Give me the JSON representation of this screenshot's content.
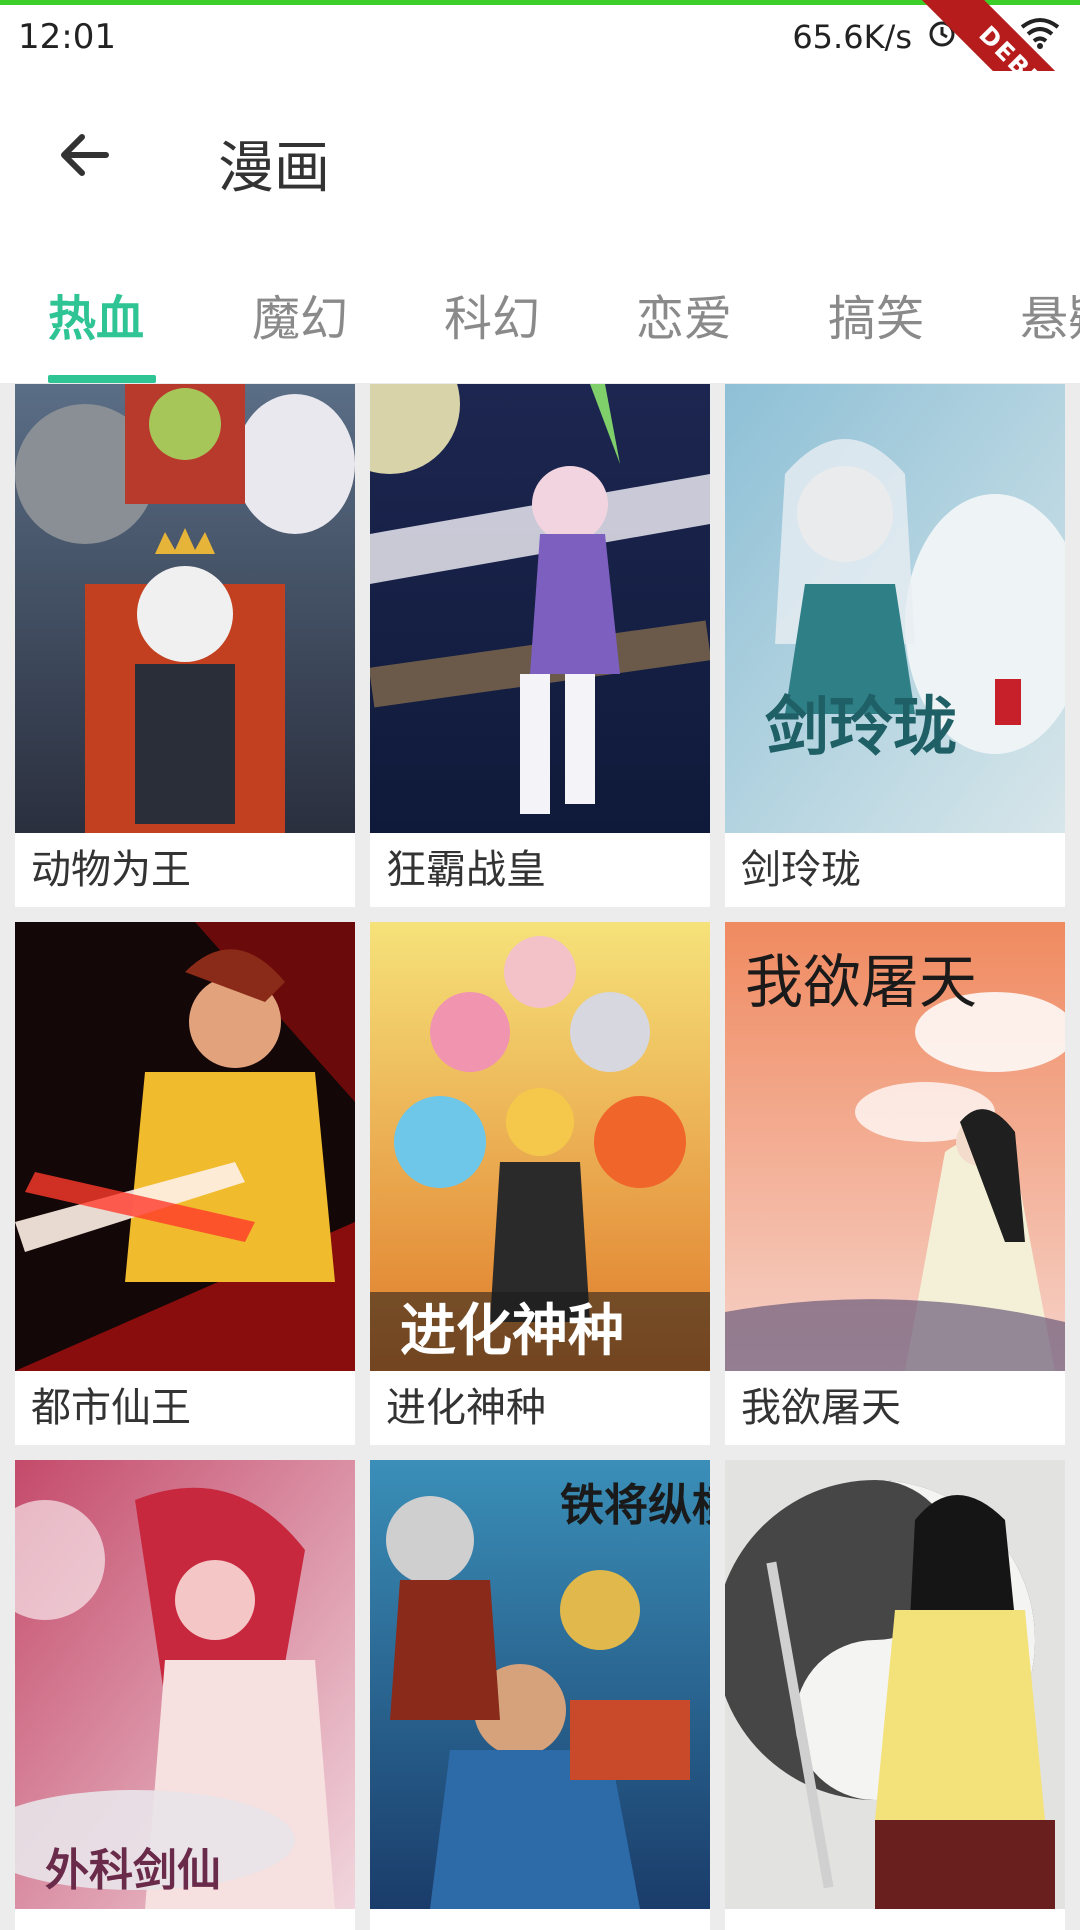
{
  "status": {
    "time": "12:01",
    "speed": "65.6K/s",
    "debug": "DEBUG"
  },
  "appbar": {
    "title": "漫画"
  },
  "tabs": [
    {
      "label": "热血",
      "active": true
    },
    {
      "label": "魔幻",
      "active": false
    },
    {
      "label": "科幻",
      "active": false
    },
    {
      "label": "恋爱",
      "active": false
    },
    {
      "label": "搞笑",
      "active": false
    },
    {
      "label": "悬疑",
      "active": false
    }
  ],
  "comics": [
    {
      "title": "动物为王",
      "cover_text": ""
    },
    {
      "title": "狂霸战皇",
      "cover_text": ""
    },
    {
      "title": "剑玲珑",
      "cover_text": "剑玲珑"
    },
    {
      "title": "都市仙王",
      "cover_text": ""
    },
    {
      "title": "进化神种",
      "cover_text": "进化神种"
    },
    {
      "title": "我欲屠天",
      "cover_text": "我欲屠天"
    },
    {
      "title": "",
      "cover_text": "外科剑仙"
    },
    {
      "title": "",
      "cover_text": "铁将纵横"
    },
    {
      "title": "",
      "cover_text": ""
    }
  ],
  "colors": {
    "accent": "#2ec494",
    "topline": "#3ccf2a"
  }
}
